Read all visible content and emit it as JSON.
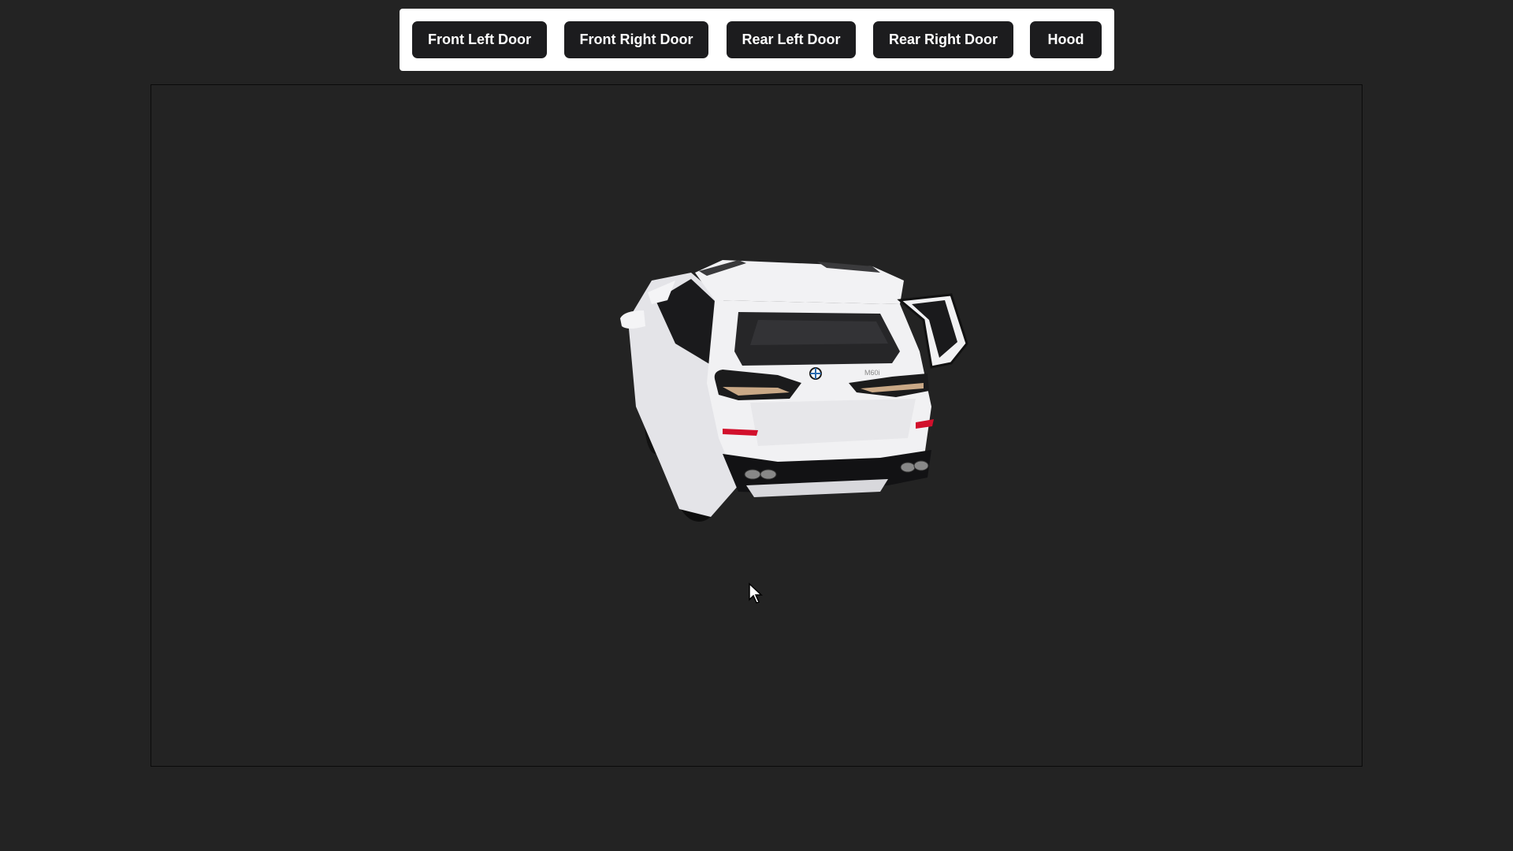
{
  "toolbar": {
    "buttons": [
      {
        "label": "Front Left Door"
      },
      {
        "label": "Front Right Door"
      },
      {
        "label": "Rear Left Door"
      },
      {
        "label": "Rear Right Door"
      },
      {
        "label": "Hood"
      }
    ]
  },
  "viewer": {
    "model": "car-rear-view",
    "badge_text": "M60i"
  },
  "colors": {
    "background": "#232323",
    "button_bg": "#1c1c1e",
    "button_text": "#ffffff",
    "toolbar_bg": "#ffffff",
    "car_body": "#f1f1f3"
  },
  "icons": {
    "cursor": "arrow-cursor-icon"
  }
}
